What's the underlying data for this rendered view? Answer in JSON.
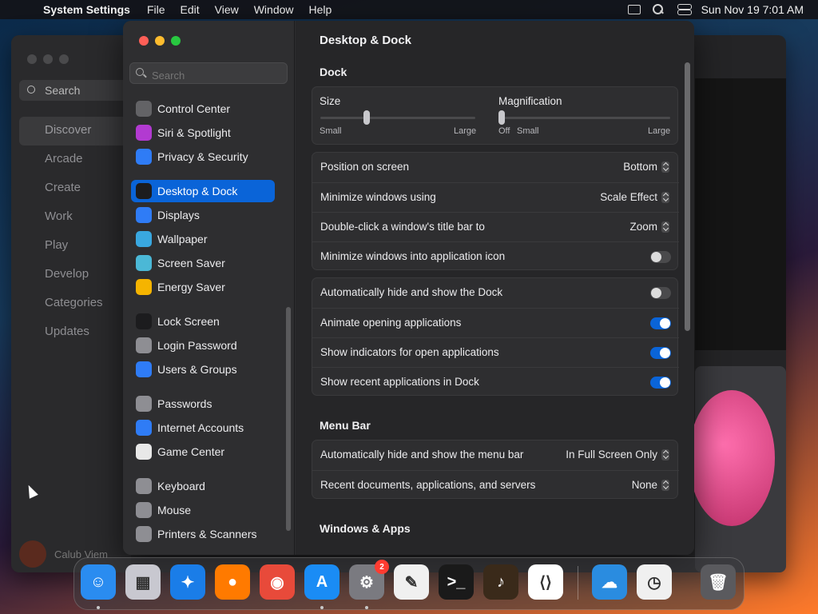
{
  "menubar": {
    "app_name": "System Settings",
    "menus": [
      "File",
      "Edit",
      "View",
      "Window",
      "Help"
    ],
    "clock": "Sun Nov 19  7:01 AM"
  },
  "appstore": {
    "search": "Search",
    "nav": [
      "Discover",
      "Arcade",
      "Create",
      "Work",
      "Play",
      "Develop",
      "Categories",
      "Updates"
    ],
    "user": "Calub Viem"
  },
  "settings": {
    "search_placeholder": "Search",
    "sidebar": [
      {
        "label": "Control Center",
        "icon": "control-center-icon",
        "color": "#636366"
      },
      {
        "label": "Siri & Spotlight",
        "icon": "siri-icon",
        "color": "#b23ad1"
      },
      {
        "label": "Privacy & Security",
        "icon": "hand-icon",
        "color": "#2f7cf6"
      },
      {
        "label": "Desktop & Dock",
        "icon": "dock-icon",
        "color": "#1c1c1e"
      },
      {
        "label": "Displays",
        "icon": "sun-icon",
        "color": "#2f7cf6"
      },
      {
        "label": "Wallpaper",
        "icon": "flower-icon",
        "color": "#39a8e0"
      },
      {
        "label": "Screen Saver",
        "icon": "screen-saver-icon",
        "color": "#4bb8d6"
      },
      {
        "label": "Energy Saver",
        "icon": "bulb-icon",
        "color": "#f5b400"
      },
      {
        "label": "Lock Screen",
        "icon": "lock-icon",
        "color": "#1c1c1e"
      },
      {
        "label": "Login Password",
        "icon": "padlock-icon",
        "color": "#8e8e93"
      },
      {
        "label": "Users & Groups",
        "icon": "users-icon",
        "color": "#2f7cf6"
      },
      {
        "label": "Passwords",
        "icon": "key-icon",
        "color": "#8e8e93"
      },
      {
        "label": "Internet Accounts",
        "icon": "at-icon",
        "color": "#2f7cf6"
      },
      {
        "label": "Game Center",
        "icon": "game-center-icon",
        "color": "#e8e8e8"
      },
      {
        "label": "Keyboard",
        "icon": "keyboard-icon",
        "color": "#8e8e93"
      },
      {
        "label": "Mouse",
        "icon": "mouse-icon",
        "color": "#8e8e93"
      },
      {
        "label": "Printers & Scanners",
        "icon": "printer-icon",
        "color": "#8e8e93"
      }
    ],
    "selected": "Desktop & Dock",
    "accent": "#0a64d8"
  },
  "content": {
    "title": "Desktop & Dock",
    "dock_section": "Dock",
    "size_label": "Size",
    "size_small": "Small",
    "size_large": "Large",
    "size_value": 0.3,
    "mag_label": "Magnification",
    "mag_off": "Off",
    "mag_small": "Small",
    "mag_large": "Large",
    "mag_value": 0.0,
    "rows1": [
      {
        "label": "Position on screen",
        "value": "Bottom"
      },
      {
        "label": "Minimize windows using",
        "value": "Scale Effect"
      },
      {
        "label": "Double-click a window's title bar to",
        "value": "Zoom"
      },
      {
        "label": "Minimize windows into application icon",
        "toggle": false
      }
    ],
    "rows2": [
      {
        "label": "Automatically hide and show the Dock",
        "toggle": false
      },
      {
        "label": "Animate opening applications",
        "toggle": true
      },
      {
        "label": "Show indicators for open applications",
        "toggle": true
      },
      {
        "label": "Show recent applications in Dock",
        "toggle": true
      }
    ],
    "menubar_section": "Menu Bar",
    "rows3": [
      {
        "label": "Automatically hide and show the menu bar",
        "value": "In Full Screen Only"
      },
      {
        "label": "Recent documents, applications, and servers",
        "value": "None"
      }
    ],
    "windows_section": "Windows & Apps"
  },
  "dock": {
    "apps": [
      {
        "name": "finder-icon",
        "glyph": "☺",
        "color": "#2a8cf0",
        "running": true
      },
      {
        "name": "launchpad-icon",
        "glyph": "▦",
        "color": "#c8c8d0",
        "running": false
      },
      {
        "name": "safari-icon",
        "glyph": "✦",
        "color": "#1a7de8",
        "running": false
      },
      {
        "name": "firefox-icon",
        "glyph": "●",
        "color": "#ff7a00",
        "running": false
      },
      {
        "name": "chrome-icon",
        "glyph": "◉",
        "color": "#e84a3a",
        "running": false
      },
      {
        "name": "app-store-icon",
        "glyph": "A",
        "color": "#1a8cf5",
        "running": true
      },
      {
        "name": "system-settings-icon",
        "glyph": "⚙",
        "color": "#7a7a80",
        "running": true,
        "badge": "2"
      },
      {
        "name": "textedit-icon",
        "glyph": "✎",
        "color": "#f0f0f0",
        "running": false
      },
      {
        "name": "terminal-icon",
        "glyph": ">_",
        "color": "#1a1a1a",
        "running": false
      },
      {
        "name": "garageband-icon",
        "glyph": "♪",
        "color": "#3a2a1a",
        "running": false
      },
      {
        "name": "vscode-icon",
        "glyph": "⟨⟩",
        "color": "#ffffff",
        "running": false
      },
      {
        "name": "weather-icon",
        "glyph": "☁",
        "color": "#2a8ce0",
        "running": false
      },
      {
        "name": "clock-icon",
        "glyph": "◷",
        "color": "#f0f0f0",
        "running": false
      },
      {
        "name": "trash-icon",
        "glyph": "🗑",
        "color": "#5a5a5e",
        "running": false
      }
    ]
  }
}
